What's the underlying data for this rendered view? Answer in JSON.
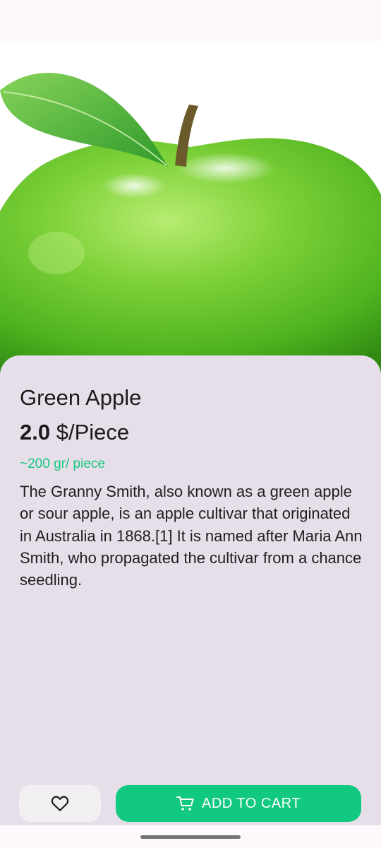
{
  "product": {
    "title": "Green Apple",
    "price_value": "2.0",
    "price_unit": "$/Piece",
    "weight": "~200 gr/ piece",
    "description": "The Granny Smith, also known as a green apple or sour apple, is an apple cultivar that originated in Australia in 1868.[1] It is named after Maria Ann Smith, who propagated the cultivar from a chance seedling."
  },
  "gallery": {
    "image_name": "green-apple-photo",
    "page_count": 2,
    "active_page": 1
  },
  "actions": {
    "favorite_icon": "heart-icon",
    "cart_icon": "cart-icon",
    "add_to_cart_label": "ADD TO CART"
  },
  "colors": {
    "accent": "#12c981",
    "sheet_background": "#e6dfea",
    "weight_text": "#14c77f"
  }
}
